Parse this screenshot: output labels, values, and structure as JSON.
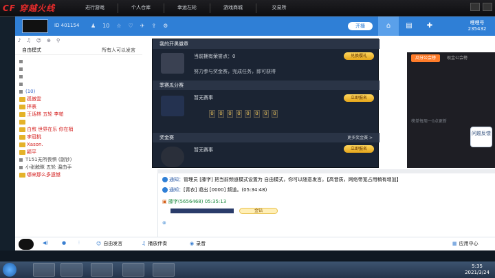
{
  "game_bar": {
    "logo": "CF 穿越火线",
    "nav": [
      "进行游戏",
      "个人仓库",
      "幸运左轮",
      "游戏商城",
      "交易所"
    ]
  },
  "client": {
    "id_text": "ID 401154",
    "count": "10",
    "open_label": "开播",
    "badge": "哩哩号",
    "badge_sub": "235432"
  },
  "left": {
    "mode": "自由模式",
    "permission": "所有人可以发言",
    "tree": [
      {
        "text": "",
        "cls": "dim"
      },
      {
        "text": "",
        "cls": "dim"
      },
      {
        "text": "",
        "cls": "dim"
      },
      {
        "text": "",
        "cls": "dim"
      },
      {
        "text": "(10)",
        "cls": "blue"
      },
      {
        "text": "孤傲雲",
        "cls": "red"
      },
      {
        "text": "拝表",
        "cls": "red"
      },
      {
        "text": "王话林  五轮 李帕",
        "cls": "red"
      },
      {
        "text": "",
        "cls": "red"
      },
      {
        "text": "白煎  世界在乐 你在梢",
        "cls": "red"
      },
      {
        "text": "李冠桃",
        "cls": "red"
      },
      {
        "text": "Xason.",
        "cls": "red"
      },
      {
        "text": "颖平",
        "cls": "red"
      },
      {
        "text": "T151无所畏惧  (副钞)",
        "cls": ""
      },
      {
        "text": "小张触眯  五轮 温由手",
        "cls": ""
      },
      {
        "text": "哪来那么多遗憾",
        "cls": "red"
      }
    ]
  },
  "center": {
    "sign_head": "我的开黑徽章",
    "sign_points": "当前拥有荣誉点：0",
    "sign_hint": "努力参与奖金赛，完成任务，即可获得",
    "exchange_btn": "兑换樱礼",
    "season_head": "季赛瓜分赛",
    "season_status": "暂无赛事",
    "signup_btn": "立即报名",
    "digits": [
      "0",
      "0",
      "0",
      "0",
      "0",
      "0",
      "0",
      "0"
    ],
    "bonus_head": "奖金赛",
    "bonus_more": "更多奖金赛 >",
    "bonus_status": "暂无赛事",
    "bonus_btn": "立即报名"
  },
  "right": {
    "tabs": [
      "瓜分公会榜",
      "现金公会榜"
    ],
    "empty_line": "榜单每周一0点更新",
    "float_btn": "问题反馈"
  },
  "chat": {
    "msg1_label": "通知：",
    "msg1": "管理员 [藤字] 把当前频道模式设置为 自由模式，你可以随意发言。【高音质，网络带宽占用稍有增加】",
    "msg2_label": "通知：",
    "msg2": "[青衣] 退出 [0000] 频道。(05:34:48)",
    "msg3": "藤字(5656468)  05:35:13",
    "gold": "金钻"
  },
  "controls": {
    "free_speak": "自由发言",
    "accompany": "播放伴奏",
    "record": "录音",
    "app_center": "应用中心"
  },
  "taskbar": {
    "time": "5:35",
    "date": "2021/3/24"
  }
}
